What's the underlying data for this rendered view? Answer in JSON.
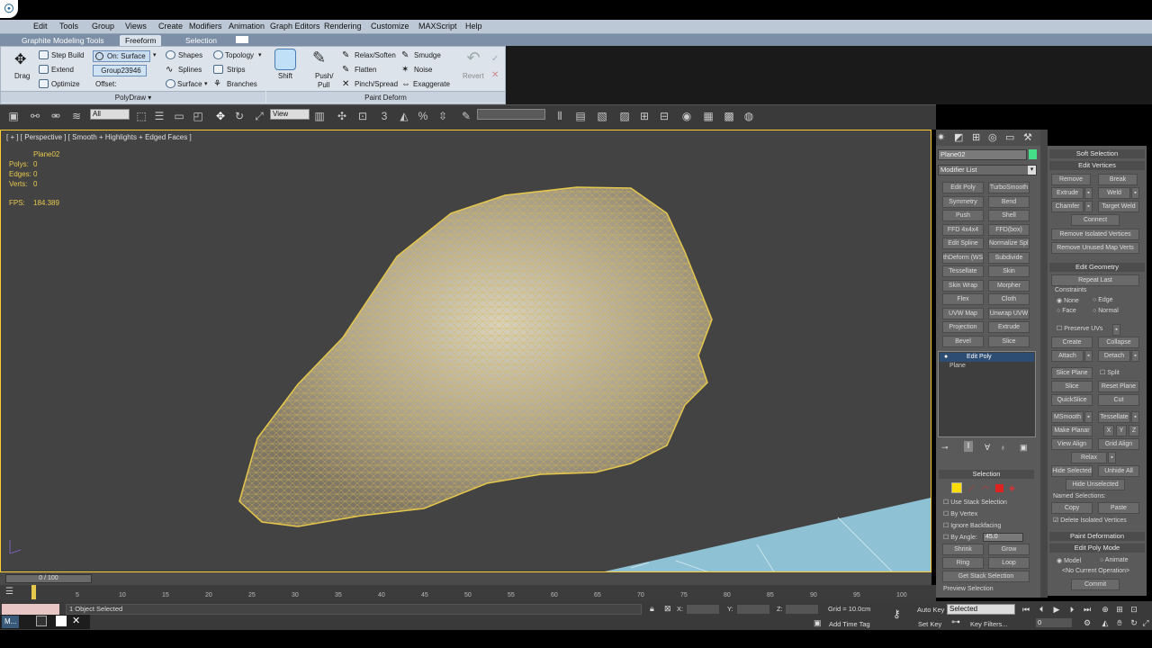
{
  "menu": [
    "Edit",
    "Tools",
    "Group",
    "Views",
    "Create",
    "Modifiers",
    "Animation",
    "Graph Editors",
    "Rendering",
    "Customize",
    "MAXScript",
    "Help"
  ],
  "ribbon_tabs": [
    "Graphite Modeling Tools",
    "Freeform",
    "Selection"
  ],
  "ribbon": {
    "drag": "Drag",
    "step_build": "Step Build",
    "extend": "Extend",
    "optimize": "Optimize",
    "on_surface": "On: Surface",
    "group": "Group23946",
    "offset": "Offset:",
    "shapes": "Shapes",
    "splines": "Splines",
    "surface": "Surface",
    "topology": "Topology",
    "strips": "Strips",
    "branches": "Branches",
    "shift": "Shift",
    "push": "Push/",
    "pull": "Pull",
    "relax_soften": "Relax/Soften",
    "flatten": "Flatten",
    "pinch_spread": "Pinch/Spread",
    "smudge": "Smudge",
    "noise": "Noise",
    "exaggerate": "Exaggerate",
    "revert": "Revert",
    "polydraw": "PolyDraw",
    "paint_deform": "Paint Deform"
  },
  "toolbar": {
    "filter": "All",
    "coord": "View"
  },
  "viewport": {
    "label": "[ + ] [ Perspective ] [ Smooth + Highlights + Edged Faces ]",
    "object": "Plane02",
    "polys_label": "Polys:",
    "polys": "0",
    "edges_label": "Edges:",
    "edges": "0",
    "verts_label": "Verts:",
    "verts": "0",
    "fps_label": "FPS:",
    "fps": "184.389"
  },
  "command": {
    "object_name": "Plane02",
    "modifier_list": "Modifier List",
    "modifiers": [
      "Edit Poly",
      "TurboSmooth",
      "Symmetry",
      "Bend",
      "Push",
      "Shell",
      "FFD 4x4x4",
      "FFD(box)",
      "Edit Spline",
      "Normalize Spl.",
      "thDeform (WS",
      "Subdivide",
      "Tessellate",
      "Skin",
      "Skin Wrap",
      "Morpher",
      "Flex",
      "Cloth",
      "UVW Map",
      "Unwrap UVW",
      "Projection",
      "Extrude",
      "Bevel",
      "Slice"
    ],
    "stack": [
      "Edit Poly",
      "Plane"
    ],
    "selection_title": "Selection",
    "use_stack": "Use Stack Selection",
    "by_vertex": "By Vertex",
    "ignore_backfacing": "Ignore Backfacing",
    "by_angle": "By Angle:",
    "angle": "45.0",
    "shrink": "Shrink",
    "grow": "Grow",
    "ring": "Ring",
    "loop": "Loop",
    "get_stack": "Get Stack Selection",
    "preview": "Preview Selection"
  },
  "rollout": {
    "soft_selection": "Soft Selection",
    "edit_vertices": "Edit Vertices",
    "remove": "Remove",
    "break": "Break",
    "extrude": "Extrude",
    "weld": "Weld",
    "chamfer": "Chamfer",
    "target_weld": "Target Weld",
    "connect": "Connect",
    "remove_isolated": "Remove Isolated Vertices",
    "remove_unused": "Remove Unused Map Verts",
    "edit_geometry": "Edit Geometry",
    "repeat_last": "Repeat Last",
    "constraints": "Constraints",
    "none": "None",
    "edge": "Edge",
    "face": "Face",
    "normal": "Normal",
    "preserve_uvs": "Preserve UVs",
    "create": "Create",
    "collapse": "Collapse",
    "attach": "Attach",
    "detach": "Detach",
    "slice_plane": "Slice Plane",
    "split": "Split",
    "slice": "Slice",
    "reset_plane": "Reset Plane",
    "quickslice": "QuickSlice",
    "cut": "Cut",
    "msmooth": "MSmooth",
    "tessellate": "Tessellate",
    "make_planar": "Make Planar",
    "x": "X",
    "y": "Y",
    "z": "Z",
    "view_align": "View Align",
    "grid_align": "Grid Align",
    "relax": "Relax",
    "hide_selected": "Hide Selected",
    "unhide_all": "Unhide All",
    "hide_unselected": "Hide Unselected",
    "named_selections": "Named Selections:",
    "copy": "Copy",
    "paste": "Paste",
    "delete_isolated": "Delete Isolated Vertices",
    "paint_deformation": "Paint Deformation",
    "edit_poly_mode": "Edit Poly Mode",
    "model": "Model",
    "animate": "Animate",
    "no_op": "<No Current Operation>",
    "commit": "Commit"
  },
  "timeline": {
    "frame": "0 / 100",
    "ticks": [
      "5",
      "10",
      "15",
      "20",
      "25",
      "30",
      "35",
      "40",
      "45",
      "50",
      "55",
      "60",
      "65",
      "70",
      "75",
      "80",
      "85",
      "90",
      "95",
      "100"
    ]
  },
  "status": {
    "selected": "1 Object Selected",
    "x": "X:",
    "y": "Y:",
    "z": "Z:",
    "grid": "Grid = 10.0cm",
    "add_time_tag": "Add Time Tag",
    "auto_key": "Auto Key",
    "set_key": "Set Key",
    "key_mode": "Selected",
    "key_filters": "Key Filters...",
    "frame_field": "0",
    "task1": "M..."
  },
  "colors": {
    "wire": "#e6c84c",
    "ground": "#8fc1d4",
    "viewport_bg": "#434343",
    "ribbon_bg": "#dce3eb"
  }
}
